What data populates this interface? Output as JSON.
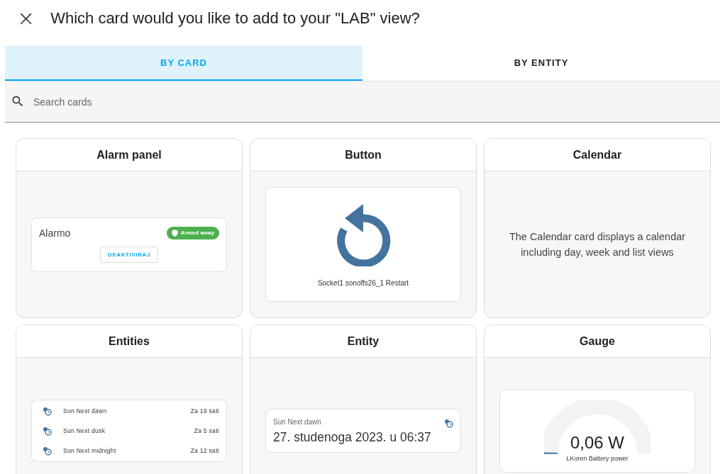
{
  "dialog": {
    "close": "×",
    "title": "Which card would you like to add to your \"LAB\" view?"
  },
  "tabs": [
    {
      "label": "BY CARD",
      "selected": true
    },
    {
      "label": "BY ENTITY",
      "selected": false
    }
  ],
  "search": {
    "placeholder": "Search cards"
  },
  "cards": [
    {
      "title": "Alarm panel",
      "kind": "alarm",
      "name": "Alarmo",
      "badge": "Armed away",
      "action": "DEAKTIVIRAJ"
    },
    {
      "title": "Button",
      "kind": "button",
      "name": "Socket1 sonoffs26_1 Restart"
    },
    {
      "title": "Calendar",
      "kind": "text",
      "text": "The Calendar card displays a calendar including day, week and list views"
    },
    {
      "title": "Entities",
      "kind": "entities",
      "rows": [
        {
          "name": "Sun Next dawn",
          "value": "Za 19 sati"
        },
        {
          "name": "Sun Next dusk",
          "value": "Za 5 sati"
        },
        {
          "name": "Sun Next midnight",
          "value": "Za 12 sati"
        }
      ]
    },
    {
      "title": "Entity",
      "kind": "entity",
      "name": "Sun Next dawn",
      "value": "27. studenoga 2023. u 06:37"
    },
    {
      "title": "Gauge",
      "kind": "gauge",
      "value": "0,06 W",
      "name": "LKoren Battery power",
      "level": 0.01
    }
  ]
}
